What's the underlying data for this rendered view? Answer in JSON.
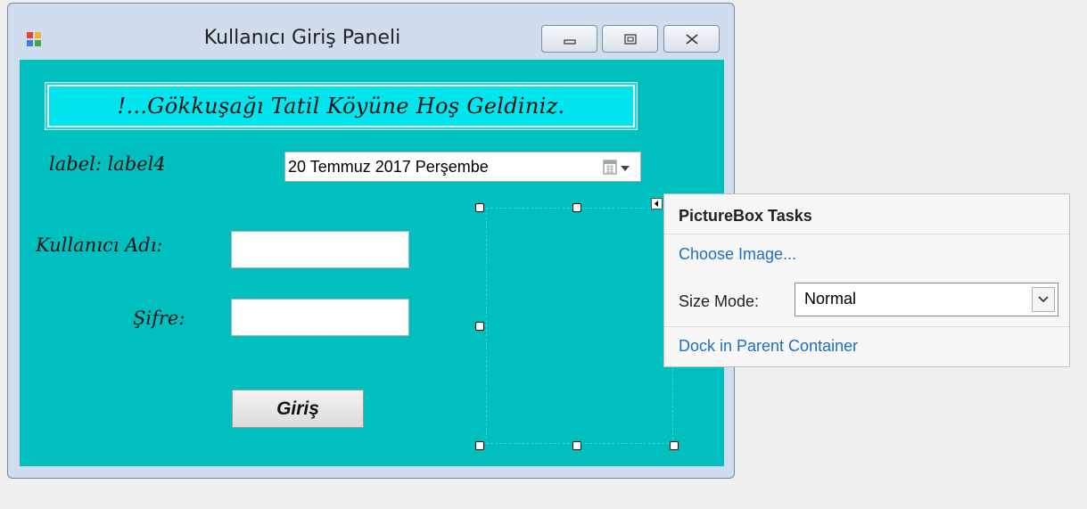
{
  "window": {
    "title": "Kullanıcı Giriş Paneli",
    "icon": "app-form-icon",
    "controls": [
      "minimize-icon",
      "maximize-icon",
      "close-icon"
    ]
  },
  "form": {
    "banner_text": "!...Gökkuşağı Tatil Köyüne Hoş Geldiniz.",
    "label_top": "label: label4",
    "date_value": "20 Temmuz 2017 Perşembe",
    "username_label": "Kullanıcı Adı:",
    "username_value": "",
    "password_label": "Şifre:",
    "password_value": "",
    "login_button": "Giriş"
  },
  "tasks_panel": {
    "title": "PictureBox Tasks",
    "choose_image": "Choose Image...",
    "size_mode_label": "Size Mode:",
    "size_mode_value": "Normal",
    "dock_link": "Dock in Parent Container"
  },
  "colors": {
    "form_background": "#00bfbf",
    "banner_background": "#00e5ee",
    "link_color": "#1f6fc1"
  }
}
